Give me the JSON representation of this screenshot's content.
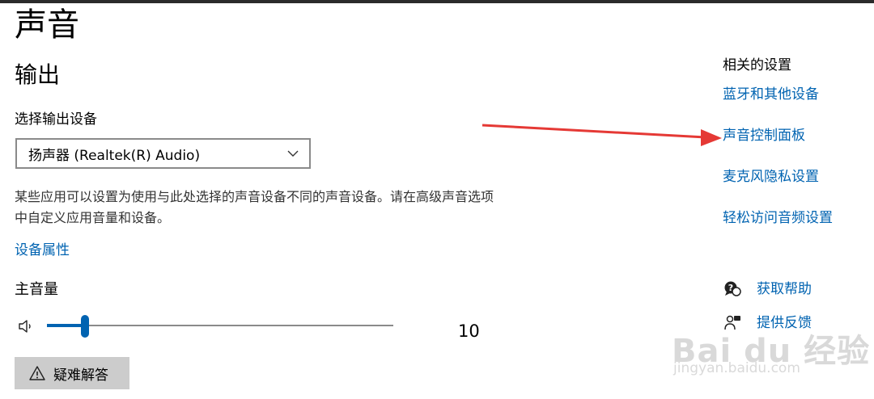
{
  "page": {
    "title": "声音"
  },
  "output": {
    "heading": "输出",
    "select_label": "选择输出设备",
    "selected_device": "扬声器 (Realtek(R) Audio)",
    "description": "某些应用可以设置为使用与此处选择的声音设备不同的声音设备。请在高级声音选项中自定义应用音量和设备。",
    "device_properties_link": "设备属性",
    "volume_label": "主音量",
    "volume_value": "10",
    "volume_fraction": 0.11,
    "troubleshoot_label": "疑难解答"
  },
  "related": {
    "heading": "相关的设置",
    "links": [
      "蓝牙和其他设备",
      "声音控制面板",
      "麦克风隐私设置",
      "轻松访问音频设置"
    ]
  },
  "help": {
    "get_help": "获取帮助",
    "give_feedback": "提供反馈"
  },
  "annotation": {
    "arrow_color": "#e53935"
  },
  "watermark": {
    "logo": "Bai du 经验",
    "url": "jingyan.baidu.com"
  },
  "colors": {
    "accent": "#0063b1",
    "button_bg": "#cccccc"
  }
}
